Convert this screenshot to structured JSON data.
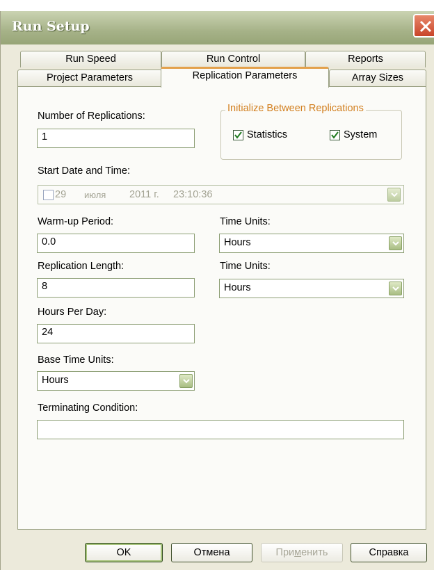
{
  "window": {
    "title": "Run Setup"
  },
  "tabs_row1": [
    {
      "label": "Run Speed"
    },
    {
      "label": "Run Control"
    },
    {
      "label": "Reports"
    }
  ],
  "tabs_row2": [
    {
      "label": "Project Parameters"
    },
    {
      "label": "Replication Parameters",
      "active": true
    },
    {
      "label": "Array Sizes"
    }
  ],
  "form": {
    "replications_label": "Number of Replications:",
    "replications_value": "1",
    "init_group_label": "Initialize Between Replications",
    "statistics_label": "Statistics",
    "statistics_checked": true,
    "system_label": "System",
    "system_checked": true,
    "start_label": "Start Date and Time:",
    "start_day": "29",
    "start_month": "июля",
    "start_year": "2011 г.",
    "start_time": "23:10:36",
    "start_enabled": false,
    "warmup_label": "Warm-up Period:",
    "warmup_value": "0.0",
    "warmup_units_label": "Time Units:",
    "warmup_units_value": "Hours",
    "replength_label": "Replication Length:",
    "replength_value": "8",
    "replength_units_label": "Time Units:",
    "replength_units_value": "Hours",
    "hours_label": "Hours Per Day:",
    "hours_value": "24",
    "base_units_label": "Base Time Units:",
    "base_units_value": "Hours",
    "terminating_label": "Terminating Condition:",
    "terminating_value": ""
  },
  "buttons": {
    "ok": "OK",
    "cancel": "Отмена",
    "apply_pre": "При",
    "apply_mnemonic": "м",
    "apply_post": "енить",
    "help": "Справка"
  },
  "colors": {
    "title_bar": "#a6b288",
    "accent_orange": "#e3a14b",
    "group_title": "#d27f1f",
    "close_button": "#c8452a"
  }
}
